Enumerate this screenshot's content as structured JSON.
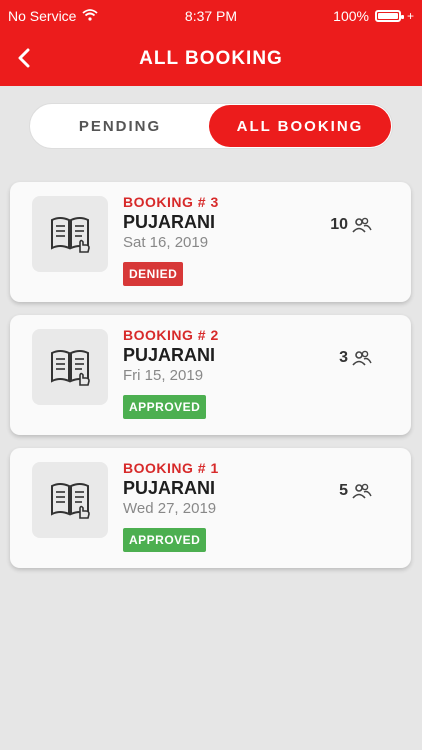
{
  "status_bar": {
    "carrier": "No Service",
    "time": "8:37 PM",
    "battery": "100%"
  },
  "header": {
    "title": "ALL BOOKING"
  },
  "tabs": [
    {
      "label": "PENDING",
      "selected": false
    },
    {
      "label": "ALL BOOKING",
      "selected": true
    }
  ],
  "bookings": [
    {
      "number": "BOOKING # 3",
      "name": "PUJARANI",
      "date": "Sat 16, 2019",
      "status": "DENIED",
      "count": "10"
    },
    {
      "number": "BOOKING # 2",
      "name": "PUJARANI",
      "date": "Fri 15, 2019",
      "status": "APPROVED",
      "count": "3"
    },
    {
      "number": "BOOKING # 1",
      "name": "PUJARANI",
      "date": "Wed 27, 2019",
      "status": "APPROVED",
      "count": "5"
    }
  ],
  "colors": {
    "accent": "#ec1c1c",
    "denied": "#d73838",
    "approved": "#4caf50",
    "background": "#e6e6e6"
  },
  "icons": {
    "back": "chevron-left-icon",
    "book": "book-hand-icon",
    "people": "people-icon",
    "wifi": "wifi-icon",
    "battery": "battery-icon"
  }
}
